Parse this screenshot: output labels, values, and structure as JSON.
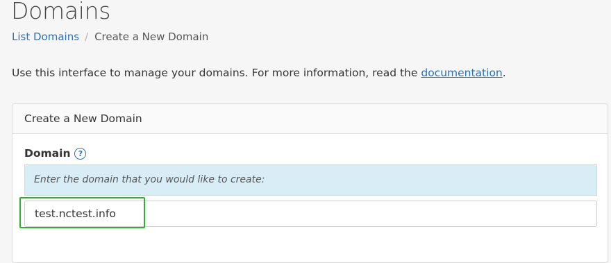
{
  "page": {
    "title": "Domains"
  },
  "breadcrumb": {
    "items": [
      {
        "label": "List Domains"
      },
      {
        "label": "Create a New Domain"
      }
    ],
    "separator": "/"
  },
  "intro": {
    "text": "Use this interface to manage your domains. For more information, read the ",
    "link_label": "documentation",
    "suffix": "."
  },
  "panel": {
    "heading": "Create a New Domain",
    "field_label": "Domain",
    "help_icon": "question-circle-icon",
    "help_glyph": "?",
    "info_text": "Enter the domain that you would like to create:",
    "input_value": "test.nctest.info"
  },
  "colors": {
    "link": "#2a72b5",
    "info_background": "#d9edf7",
    "highlight": "#2fb12f"
  }
}
